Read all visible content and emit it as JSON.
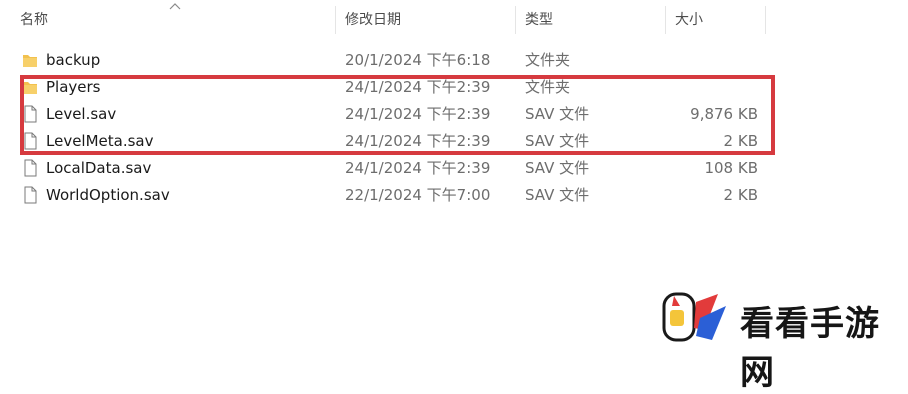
{
  "columns": {
    "name": "名称",
    "modified": "修改日期",
    "type": "类型",
    "size": "大小"
  },
  "sort_indicator": "sort-ascending-chevron-icon",
  "files": [
    {
      "name": "backup",
      "modified": "20/1/2024 下午6:18",
      "type": "文件夹",
      "size": "",
      "icon": "folder-icon"
    },
    {
      "name": "Players",
      "modified": "24/1/2024 下午2:39",
      "type": "文件夹",
      "size": "",
      "icon": "folder-icon"
    },
    {
      "name": "Level.sav",
      "modified": "24/1/2024 下午2:39",
      "type": "SAV 文件",
      "size": "9,876 KB",
      "icon": "file-icon"
    },
    {
      "name": "LevelMeta.sav",
      "modified": "24/1/2024 下午2:39",
      "type": "SAV 文件",
      "size": "2 KB",
      "icon": "file-icon"
    },
    {
      "name": "LocalData.sav",
      "modified": "24/1/2024 下午2:39",
      "type": "SAV 文件",
      "size": "108 KB",
      "icon": "file-icon"
    },
    {
      "name": "WorldOption.sav",
      "modified": "22/1/2024 下午7:00",
      "type": "SAV 文件",
      "size": "2 KB",
      "icon": "file-icon"
    }
  ],
  "highlight_color": "#d63a3f",
  "folder_color": "#f2c14e",
  "watermark": {
    "text": "看看手游网",
    "logo": "kankan-logo-icon"
  }
}
